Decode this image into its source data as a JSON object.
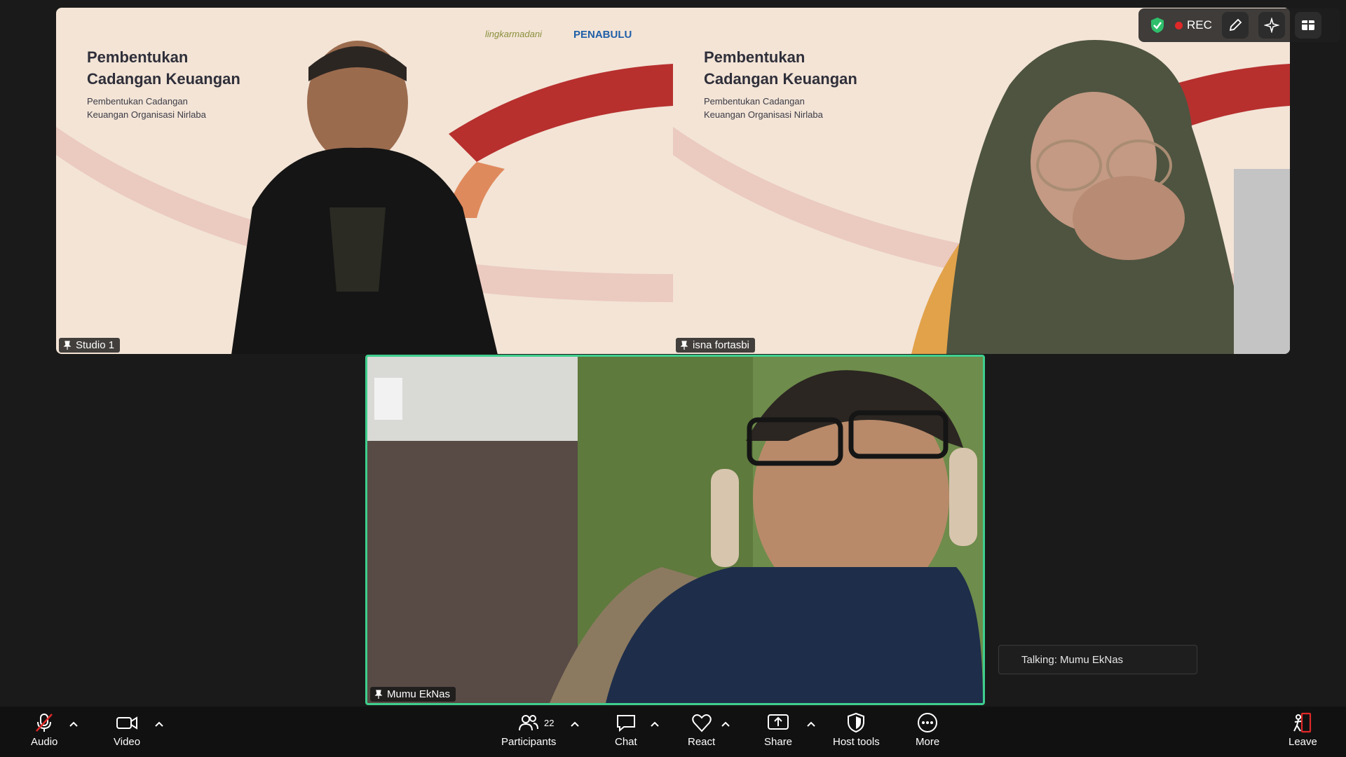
{
  "tiles": {
    "studio": {
      "name": "Studio 1"
    },
    "isna": {
      "name": "isna fortasbi"
    },
    "mumu": {
      "name": "Mumu EkNas"
    }
  },
  "slide": {
    "title": "Pembentukan\nCadangan Keuangan",
    "subtitle": "Pembentukan Cadangan\nKeuangan Organisasi Nirlaba",
    "logo_left": "lingkarmadani",
    "logo_right": "PENABULU"
  },
  "top_right": {
    "rec_label": "REC"
  },
  "talking": "Talking: Mumu EkNas",
  "toolbar": {
    "audio": "Audio",
    "video": "Video",
    "participants": "Participants",
    "participants_count": "22",
    "chat": "Chat",
    "react": "React",
    "share": "Share",
    "host_tools": "Host tools",
    "more": "More",
    "leave": "Leave"
  },
  "colors": {
    "active_speaker": "#3ecf8e",
    "rec": "#e02828",
    "leave": "#e02828"
  }
}
